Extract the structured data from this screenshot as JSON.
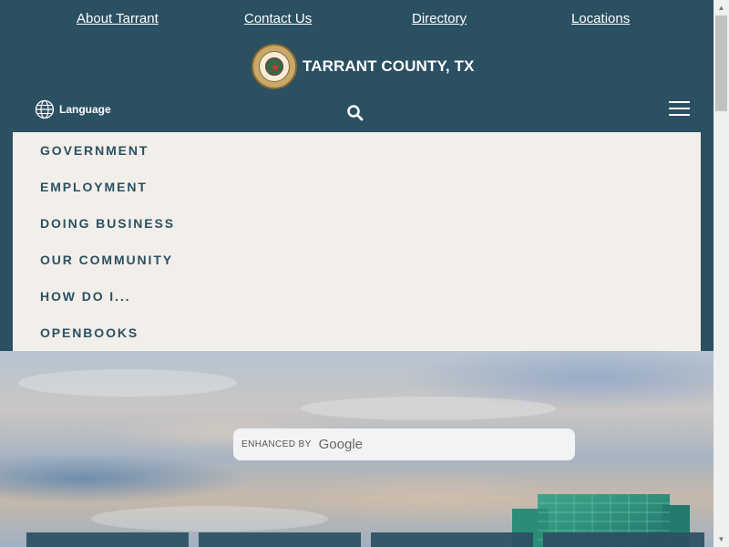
{
  "top_links": [
    {
      "label": "About Tarrant"
    },
    {
      "label": "Contact Us"
    },
    {
      "label": "Directory"
    },
    {
      "label": "Locations"
    }
  ],
  "brand": {
    "name": "TARRANT COUNTY, TX"
  },
  "utility": {
    "language_label": "Language"
  },
  "nav": {
    "items": [
      {
        "label": "GOVERNMENT"
      },
      {
        "label": "EMPLOYMENT"
      },
      {
        "label": "DOING BUSINESS"
      },
      {
        "label": "OUR COMMUNITY"
      },
      {
        "label": "HOW DO I..."
      },
      {
        "label": "OPENBOOKS"
      }
    ]
  },
  "search": {
    "enhanced_by": "ENHANCED BY",
    "provider": "Google"
  },
  "colors": {
    "header_bg": "#2b5062",
    "nav_bg": "#f2efea",
    "nav_text": "#2b5062",
    "link": "#ffffff"
  },
  "icons": {
    "language": "globe-icon",
    "search": "search-icon",
    "menu": "hamburger-icon"
  }
}
